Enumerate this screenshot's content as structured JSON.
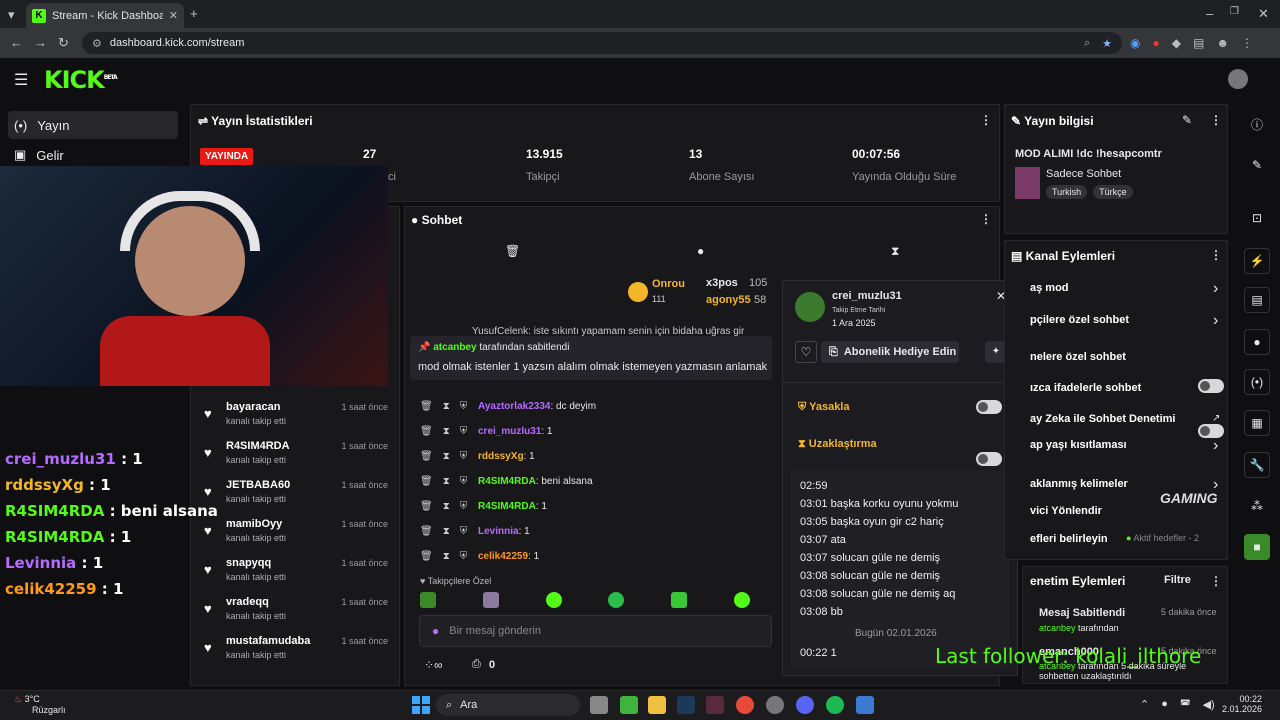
{
  "browser": {
    "tab_title": "Stream - Kick Dashboard",
    "url": "dashboard.kick.com/stream"
  },
  "kick": {
    "logo": "KICK",
    "beta": "BETA"
  },
  "nav": [
    {
      "label": "Yayın",
      "icon": "(•)"
    },
    {
      "label": "Gelir",
      "icon": "▣"
    }
  ],
  "stats": {
    "title": "Yayın İstatistikleri",
    "live": "YAYINDA",
    "items": [
      {
        "n": "27",
        "l": "İzleyici"
      },
      {
        "n": "13.915",
        "l": "Takipçi"
      },
      {
        "n": "13",
        "l": "Abone Sayısı"
      },
      {
        "n": "00:07:56",
        "l": "Yayında Olduğu Süre"
      }
    ]
  },
  "info": {
    "title": "Yayın bilgisi",
    "stream_title": "MOD ALIMI !dc !hesapcomtr",
    "category": "Sadece Sohbet",
    "tags": [
      "Turkish",
      "Türkçe"
    ]
  },
  "overlay_chat": [
    {
      "name": "crei_muzlu31",
      "val": " : 1",
      "color": "#b56bff"
    },
    {
      "name": "rddssyXg",
      "val": " : 1",
      "color": "#f3b62b"
    },
    {
      "name": "R4SIM4RDA",
      "val": " : beni alsana",
      "color": "#53fc18"
    },
    {
      "name": "R4SIM4RDA",
      "val": " : 1",
      "color": "#53fc18"
    },
    {
      "name": "Levinnia",
      "val": " : 1",
      "color": "#b56bff"
    },
    {
      "name": "celik42259",
      "val": " : 1",
      "color": "#ff9a1a"
    }
  ],
  "follows": {
    "sub": "kanalı takip etti",
    "items": [
      {
        "name": "bayaracan",
        "time": "1 saat önce"
      },
      {
        "name": "R4SIM4RDA",
        "time": "1 saat önce"
      },
      {
        "name": "JETBABA60",
        "time": "1 saat önce"
      },
      {
        "name": "mamibOyy",
        "time": "1 saat önce"
      },
      {
        "name": "snapyqq",
        "time": "1 saat önce"
      },
      {
        "name": "vradeqq",
        "time": "1 saat önce"
      },
      {
        "name": "mustafamudaba",
        "time": "1 saat önce"
      }
    ]
  },
  "chat": {
    "title": "Sohbet",
    "leaders": [
      {
        "name": "Onrou",
        "val": "111"
      },
      {
        "name": "x3pos",
        "val": "105"
      },
      {
        "name": "agony55",
        "val": "58"
      }
    ],
    "cut_line": "YusufCelenk: iste sıkıntı yapamam senin için bidaha uğras gir",
    "pinned_by": "atcanbey",
    "pinned_label": "tarafından sabitlendi",
    "pinned_msg": "mod olmak istenler 1 yazsın alalım olmak istemeyen yazmasın anlamak",
    "lines": [
      {
        "user": "Ayaztorlak2334",
        "msg": ": dc deyim",
        "color": "#b56bff"
      },
      {
        "user": "crei_muzlu31",
        "msg": ": 1",
        "color": "#b56bff"
      },
      {
        "user": "rddssyXg",
        "msg": ": 1",
        "color": "#f3b62b"
      },
      {
        "user": "R4SIM4RDA",
        "msg": ": beni alsana",
        "color": "#53fc18"
      },
      {
        "user": "R4SIM4RDA",
        "msg": ": 1",
        "color": "#53fc18"
      },
      {
        "user": "Levinnia",
        "msg": ": 1",
        "color": "#b56bff"
      },
      {
        "user": "celik42259",
        "msg": ": 1",
        "color": "#ff9a1a"
      }
    ],
    "followers_only": "Takipçilere Özel",
    "placeholder": "Bir mesaj gönderin",
    "count": "0"
  },
  "user_card": {
    "name": "crei_muzlu31",
    "follow_label": "Takip Etme Tarihi",
    "follow_date": "1 Ara 2025",
    "gift": "Abonelik Hediye Edin",
    "ban": "Yasakla",
    "timeout": "Uzaklaştırma",
    "log": [
      {
        "t": "02:59",
        "m": ""
      },
      {
        "t": "03:01",
        "m": "başka korku oyunu yokmu"
      },
      {
        "t": "03:05",
        "m": "başka oyun gir c2 hariç"
      },
      {
        "t": "03:07",
        "m": "ata"
      },
      {
        "t": "03:07",
        "m": "solucan güle ne demiş"
      },
      {
        "t": "03:08",
        "m": "solucan güle ne demiş"
      },
      {
        "t": "03:08",
        "m": "solucan güle ne demiş aq"
      },
      {
        "t": "03:08",
        "m": "bb"
      }
    ],
    "today": "Bugün 02.01.2026",
    "last": {
      "t": "00:22",
      "m": "1"
    }
  },
  "channel_actions": {
    "title": "Kanal Eylemleri",
    "items": [
      "aş mod",
      "pçilere özel sohbet",
      "nelere özel sohbet",
      "ızca ifadelerle sohbet",
      "ay Zeka ile Sohbet Denetimi",
      "ap yaşı kısıtlaması",
      "aklanmış kelimeler",
      "vici Yönlendir",
      "efleri belirleyin"
    ],
    "goal": "Aktif hedefler - 2"
  },
  "mod_actions": {
    "title": "enetim Eylemleri",
    "filter": "Filtre",
    "items": [
      {
        "title": "Mesaj Sabitlendi",
        "time": "5 dakika önce",
        "by": "atcanbey",
        "desc": "tarafından"
      },
      {
        "title": "emanch000",
        "time": "5 dakika önce",
        "by": "atcanbey",
        "desc": "tarafından 5 dakika süreyle sohbetten uzaklaştırıldı"
      }
    ]
  },
  "overlay_follower": "Last follower: kolali_ilthore",
  "watermark": "GAMING",
  "taskbar": {
    "weather": "3°C",
    "weather_desc": "Rüzgarlı",
    "search": "Ara",
    "time": "00:22",
    "date": "2.01.2026"
  }
}
